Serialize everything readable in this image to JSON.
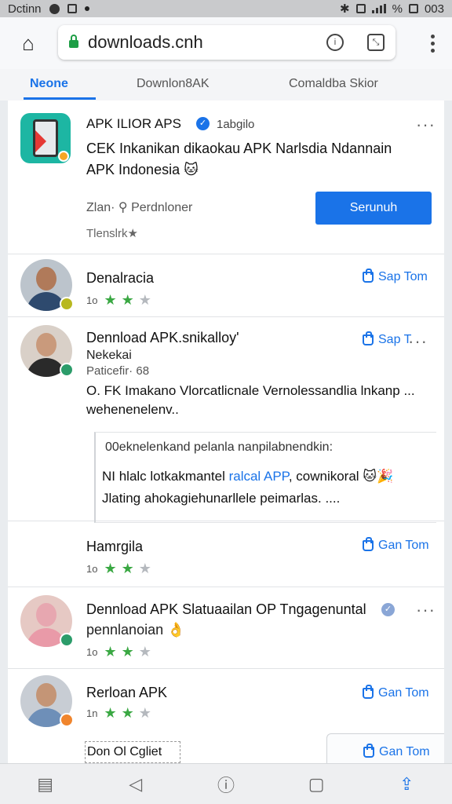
{
  "status_bar": {
    "carrier": "Dctinn",
    "right_text": "003",
    "percent_text": "%"
  },
  "url_bar": {
    "url": "downloads.cnh"
  },
  "tabs": [
    {
      "label": "Neone",
      "active": true
    },
    {
      "label": "Downlon8AK",
      "active": false
    },
    {
      "label": "Comaldba Skior",
      "active": false
    }
  ],
  "app_card": {
    "name": "APK ILIOR APS",
    "tag": "1abgilo",
    "description_line1": "CEK Inkanikan dikaokau APK Narlsdia Ndannain",
    "description_line2": "APK Indonesia 🐱",
    "meta_left": "Zlan·",
    "meta_right": "Perdnloner",
    "rating_text": "Tlenslrk★",
    "button_label": "Serunuh",
    "more": "···"
  },
  "posts": [
    {
      "name": "Denalracia",
      "stars_label": "1o",
      "action_label": "Sap Tom"
    },
    {
      "name": "Dennload APK.snikalloy'",
      "sub": "Nekekai",
      "meta": "Paticefir· 68",
      "body_line1": "O. FK Imakano Vlorcatlicnale Vernolessandlia lnkanp ...",
      "body_line2": "wehenenelenv..",
      "action_label": "Sap T",
      "more": "···"
    }
  ],
  "quote": {
    "title": "00eknelenkand  pelanla nanpilabnendkin:",
    "line1_prefix": "NI  hlalc lotkakmantel ",
    "line1_highlight": "ralcal  APP",
    "line1_suffix": ", cownikoral 🐱🎉",
    "line2": "Jlating ahokagiehunarllele peimarlas. ...."
  },
  "posts2": [
    {
      "name": "Hamrgila",
      "stars_label": "1o",
      "action_label": "Gan Tom"
    },
    {
      "name": "Dennload APK Slatuaailan OP Tngagenuntal",
      "sub": "pennlanoian 👌",
      "stars_label": "1o",
      "more": "···"
    },
    {
      "name": "Rerloan APK",
      "stars_label": "1n",
      "action_label": "Gan Tom"
    }
  ],
  "compose_chip": "Don Ol Cgliet",
  "floating_action_label": "Gan Tom",
  "colors": {
    "accent": "#1a73e8",
    "star_on": "#3aa843",
    "star_off": "#b5b9be",
    "app_icon_bg": "#1db6a3"
  },
  "icons": {
    "home": "home-icon",
    "lock": "lock-icon",
    "reader": "reader-icon",
    "tab_switch": "tab-switcher-icon",
    "menu": "more-vert-icon",
    "nav": [
      "tabs-icon",
      "back-icon",
      "info-icon",
      "chat-icon",
      "share-icon"
    ]
  }
}
